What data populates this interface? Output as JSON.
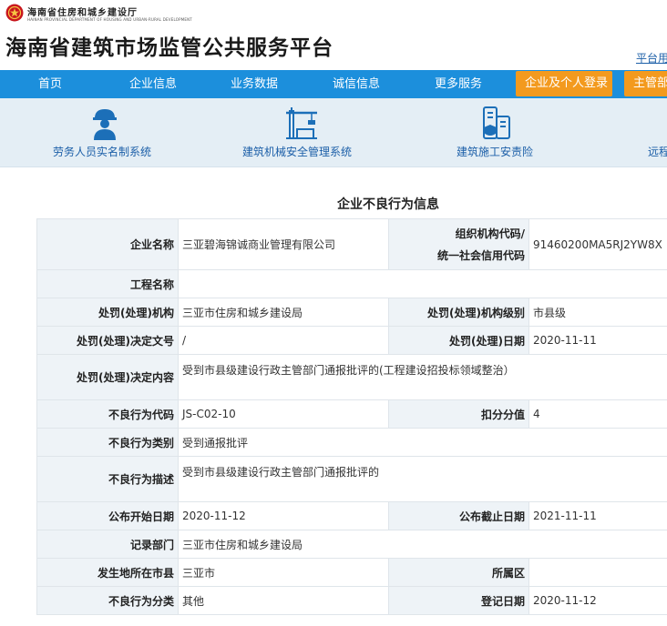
{
  "header": {
    "dept_cn": "海南省住房和城乡建设厅",
    "dept_en": "HAINAN PROVINCIAL DEPARTMENT OF HOUSING AND URBAN-RURAL DEVELOPMENT",
    "site_title": "海南省建筑市场监管公共服务平台",
    "platform_link": "平台用户"
  },
  "nav": {
    "items": [
      "首页",
      "企业信息",
      "业务数据",
      "诚信信息",
      "更多服务"
    ],
    "login_button": "企业及个人登录",
    "admin_button": "主管部门"
  },
  "quick_links": [
    {
      "label": "劳务人员实名制系统",
      "icon": "worker-icon"
    },
    {
      "label": "建筑机械安全管理系统",
      "icon": "crane-icon"
    },
    {
      "label": "建筑施工安责险",
      "icon": "insurance-building-icon"
    },
    {
      "label": "远程",
      "icon": ""
    }
  ],
  "section_title": "企业不良行为信息",
  "record": {
    "company_name_label": "企业名称",
    "company_name": "三亚碧海锦诚商业管理有限公司",
    "org_code_label_1": "组织机构代码/",
    "org_code_label_2": "统一社会信用代码",
    "org_code": "91460200MA5RJ2YW8X",
    "project_name_label": "工程名称",
    "project_name": "",
    "punish_org_label": "处罚(处理)机构",
    "punish_org": "三亚市住房和城乡建设局",
    "punish_level_label": "处罚(处理)机构级别",
    "punish_level": "市县级",
    "decision_no_label": "处罚(处理)决定文号",
    "decision_no": "/",
    "punish_date_label": "处罚(处理)日期",
    "punish_date": "2020-11-11",
    "decision_content_label": "处罚(处理)决定内容",
    "decision_content": "受到市县级建设行政主管部门通报批评的(工程建设招投标领域整治）",
    "bad_code_label": "不良行为代码",
    "bad_code": "JS-C02-10",
    "score_label": "扣分分值",
    "score": "4",
    "bad_category_label": "不良行为类别",
    "bad_category": "受到通报批评",
    "bad_desc_label": "不良行为描述",
    "bad_desc": "受到市县级建设行政主管部门通报批评的",
    "publish_start_label": "公布开始日期",
    "publish_start": "2020-11-12",
    "publish_end_label": "公布截止日期",
    "publish_end": "2021-11-11",
    "record_dept_label": "记录部门",
    "record_dept": "三亚市住房和城乡建设局",
    "city_label": "发生地所在市县",
    "city": "三亚市",
    "district_label": "所属区",
    "district": "",
    "bad_class_label": "不良行为分类",
    "bad_class": "其他",
    "register_date_label": "登记日期",
    "register_date": "2020-11-12"
  },
  "colors": {
    "nav_bg": "#1c8fdc",
    "button_bg": "#f39a1e",
    "quick_bg": "#e4eef5",
    "label_bg": "#eef3f7",
    "link": "#1c5fa8"
  }
}
